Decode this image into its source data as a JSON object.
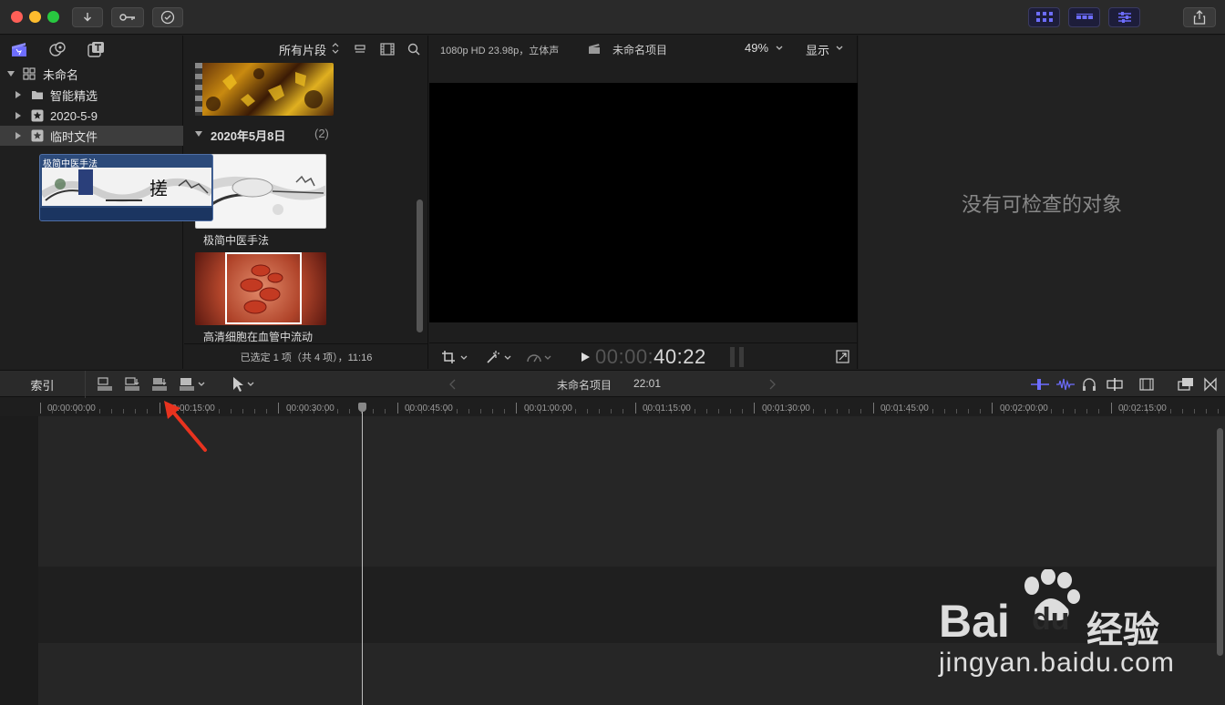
{
  "titlebar": {
    "colors": {
      "close": "#fe5f57",
      "minimize": "#febc2e",
      "zoom": "#28c840"
    }
  },
  "library": {
    "items": [
      {
        "label": "未命名",
        "level": 0,
        "expanded": true,
        "icon": "library-icon"
      },
      {
        "label": "智能精选",
        "level": 1,
        "icon": "folder-icon"
      },
      {
        "label": "2020-5-9",
        "level": 1,
        "icon": "event-star-icon"
      },
      {
        "label": "临时文件",
        "level": 1,
        "icon": "event-star-icon",
        "selected": true
      }
    ]
  },
  "browser": {
    "filter_label": "所有片段",
    "group_header": "2020年5月8日",
    "group_count": "(2)",
    "clips": [
      {
        "label": "极简中医手法"
      },
      {
        "label": "高清细胞在血管中流动"
      }
    ],
    "status": "已选定 1 项（共 4 项），11:16"
  },
  "viewer": {
    "format": "1080p HD 23.98p，立体声",
    "project_name": "未命名项目",
    "zoom": "49%",
    "display_label": "显示",
    "timecode_dim": "00:00:",
    "timecode_bright": "40:22"
  },
  "inspector": {
    "empty_message": "没有可检查的对象"
  },
  "timeline": {
    "index_label": "索引",
    "project_name": "未命名项目",
    "duration": "22:01",
    "ruler_labels": [
      "00:00:00:00",
      "00:00:15:00",
      "00:00:30:00",
      "00:00:45:00",
      "00:01:00:00",
      "00:01:15:00",
      "00:01:30:00",
      "00:01:45:00",
      "00:02:00:00",
      "00:02:15:00"
    ],
    "clip_name": "极简中医手法",
    "accent": "#2c4a7a"
  },
  "watermark": {
    "brand": "Bai",
    "brand2": "du",
    "cn": "经验",
    "url": "jingyan.baidu.com"
  }
}
